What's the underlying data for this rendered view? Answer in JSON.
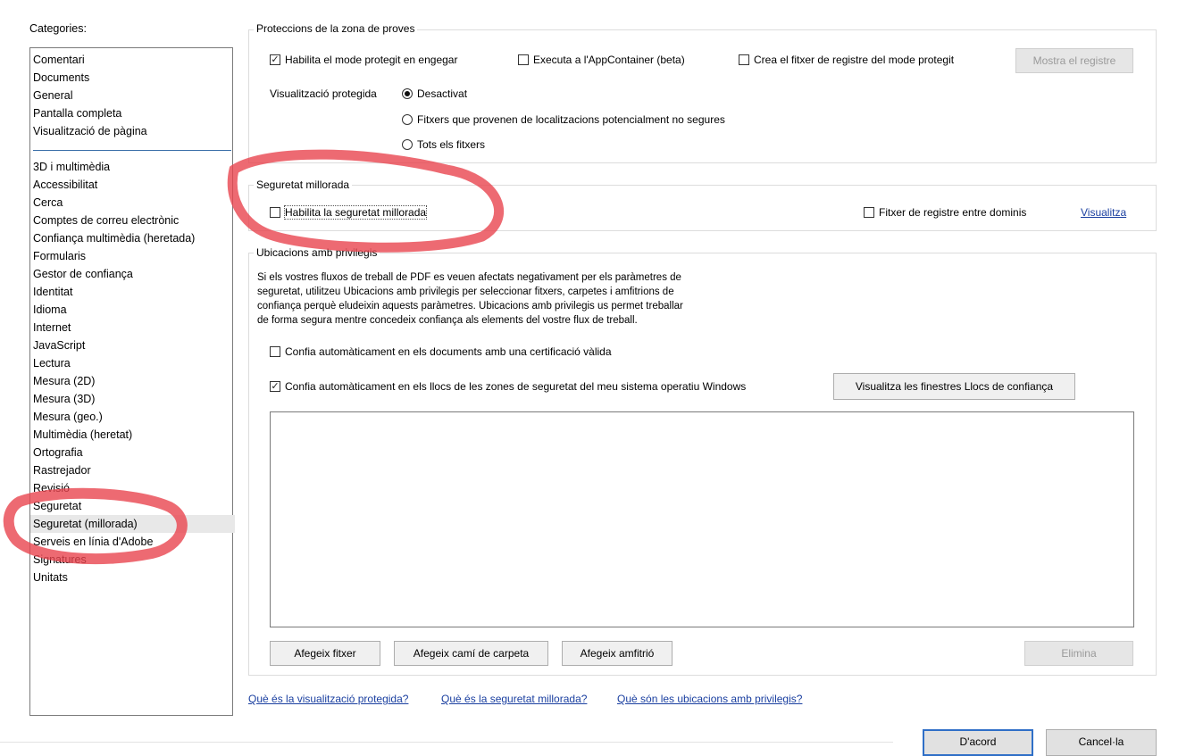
{
  "categories": {
    "title": "Categories:",
    "top_items": [
      "Comentari",
      "Documents",
      "General",
      "Pantalla completa",
      "Visualització de pàgina"
    ],
    "items": [
      "3D i multimèdia",
      "Accessibilitat",
      "Cerca",
      "Comptes de correu electrònic",
      "Confiança multimèdia (heretada)",
      "Formularis",
      "Gestor de confiança",
      "Identitat",
      "Idioma",
      "Internet",
      "JavaScript",
      "Lectura",
      "Mesura (2D)",
      "Mesura (3D)",
      "Mesura (geo.)",
      "Multimèdia (heretat)",
      "Ortografia",
      "Rastrejador",
      "Revisió",
      "Seguretat",
      "Seguretat (millorada)",
      "Serveis en línia d'Adobe",
      "Signatures",
      "Unitats"
    ],
    "selected": "Seguretat (millorada)"
  },
  "sandbox": {
    "title": "Proteccions de la zona de proves",
    "protected_mode": {
      "label": "Habilita el mode protegit en engegar",
      "checked": true
    },
    "appcontainer": {
      "label": "Executa a l'AppContainer (beta)",
      "checked": false
    },
    "log_file": {
      "label": "Crea el fitxer de registre del mode protegit",
      "checked": false
    },
    "show_log_button": "Mostra el registre",
    "protected_view_label": "Visualització protegida",
    "options": [
      "Desactivat",
      "Fitxers que provenen de localitzacions potencialment no segures",
      "Tots els fitxers"
    ],
    "selected_option": "Desactivat"
  },
  "enhanced": {
    "title": "Seguretat millorada",
    "enable": {
      "label": "Habilita la seguretat millorada",
      "checked": false
    },
    "cross_domain": {
      "label": "Fitxer de registre entre dominis",
      "checked": false
    },
    "view_link": "Visualitza"
  },
  "privileged": {
    "title": "Ubicacions amb privilegis",
    "description": [
      "Si els vostres fluxos de treball de PDF es veuen afectats negativament per els paràmetres de",
      "seguretat, utilitzeu Ubicacions amb privilegis per seleccionar fitxers, carpetes i amfitrions de",
      "confiança perquè eludeixin aquests paràmetres. Ubicacions amb privilegis us permet treballar",
      "de forma segura mentre concedeix confiança als elements del vostre flux de treball."
    ],
    "trust_certified": {
      "label": "Confia automàticament en els documents amb una certificació vàlida",
      "checked": false
    },
    "trust_os_zones": {
      "label": "Confia automàticament en els llocs de les zones de seguretat del meu sistema operatiu Windows",
      "checked": true
    },
    "view_trusted_button": "Visualitza les finestres Llocs de confiança",
    "add_file_button": "Afegeix fitxer",
    "add_folder_button": "Afegeix camí de carpeta",
    "add_host_button": "Afegeix amfitrió",
    "remove_button": "Elimina"
  },
  "help_links": [
    "Què és la visualització protegida?",
    "Què és la seguretat millorada?",
    "Què són les ubicacions amb privilegis?"
  ],
  "dialog_buttons": {
    "ok": "D'acord",
    "cancel": "Cancel·la"
  },
  "colors": {
    "highlight_red": "#e8454f",
    "link": "#1a3fa0"
  }
}
